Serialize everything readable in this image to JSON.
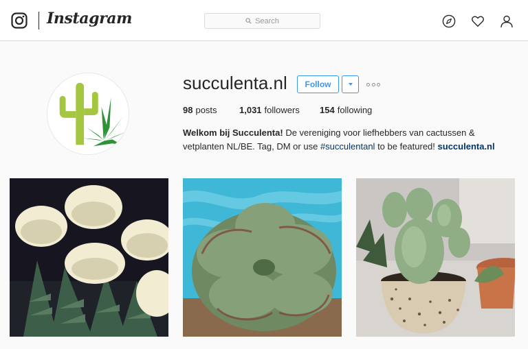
{
  "nav": {
    "brand_name": "Instagram",
    "search_placeholder": "Search",
    "icons": [
      "instagram-glyph-icon",
      "search-icon",
      "compass-icon",
      "heart-icon",
      "person-icon"
    ]
  },
  "profile": {
    "username": "succulenta.nl",
    "follow_label": "Follow",
    "stats": {
      "posts_count": "98",
      "posts_label": "posts",
      "followers_count": "1,031",
      "followers_label": "followers",
      "following_count": "154",
      "following_label": "following"
    },
    "bio": {
      "full_name": "Welkom bij Succulenta!",
      "text_1": "De vereniging voor liefhebbers van cactussen &",
      "text_2": "vetplanten NL/BE. Tag, DM or use",
      "hashtag": "#succulentanl",
      "text_3": "to be featured!",
      "link": "succulenta.nl"
    }
  },
  "posts": [
    {
      "subject": "white-flowering-crassula-photo"
    },
    {
      "subject": "frilly-echeveria-poolside-photo"
    },
    {
      "subject": "opuntia-cactus-in-pot-photo"
    }
  ],
  "colors": {
    "accent_blue": "#3897f0",
    "link_blue": "#003569",
    "text": "#262626",
    "border": "#dbdbdb",
    "background": "#fafafa"
  }
}
